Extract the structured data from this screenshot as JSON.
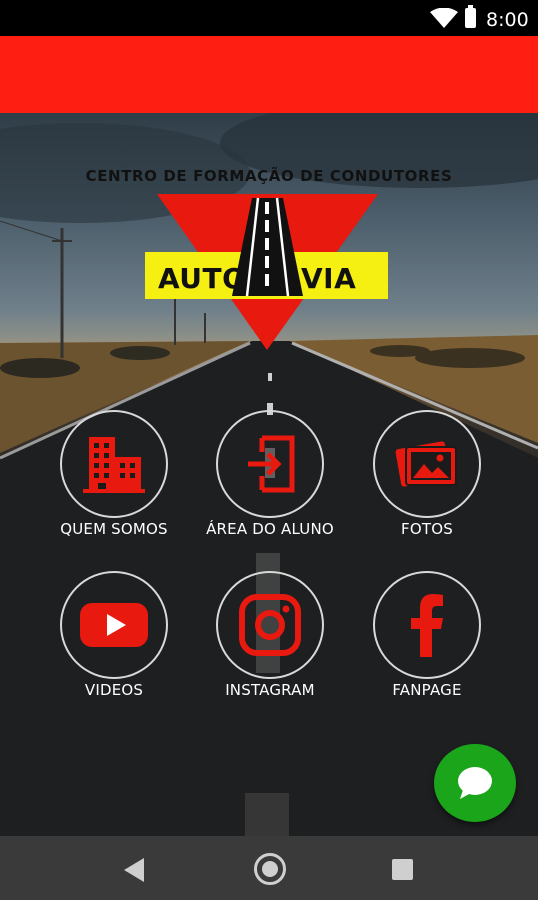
{
  "status_bar": {
    "time": "8:00",
    "icons": [
      "wifi-icon",
      "battery-icon"
    ]
  },
  "colors": {
    "app_bar": "#ff1f12",
    "accent": "#e8190f",
    "logo_yellow": "#f5ef12",
    "fab": "#1aa51a",
    "nav_bar": "#3a3a3a"
  },
  "brand": {
    "tagline": "CENTRO DE FORMAÇÃO DE CONDUTORES",
    "name_left": "AUTO",
    "name_right": "VIA"
  },
  "menu": [
    {
      "label": "QUEM SOMOS",
      "icon": "buildings-icon"
    },
    {
      "label": "ÁREA DO ALUNO",
      "icon": "login-icon"
    },
    {
      "label": "FOTOS",
      "icon": "photos-icon"
    },
    {
      "label": "VIDEOS",
      "icon": "youtube-icon"
    },
    {
      "label": "INSTAGRAM",
      "icon": "instagram-icon"
    },
    {
      "label": "FANPAGE",
      "icon": "facebook-icon"
    }
  ],
  "fab": {
    "icon": "chat-icon"
  },
  "nav_bar": {
    "icons": [
      "back-icon",
      "home-icon",
      "recents-icon"
    ]
  }
}
